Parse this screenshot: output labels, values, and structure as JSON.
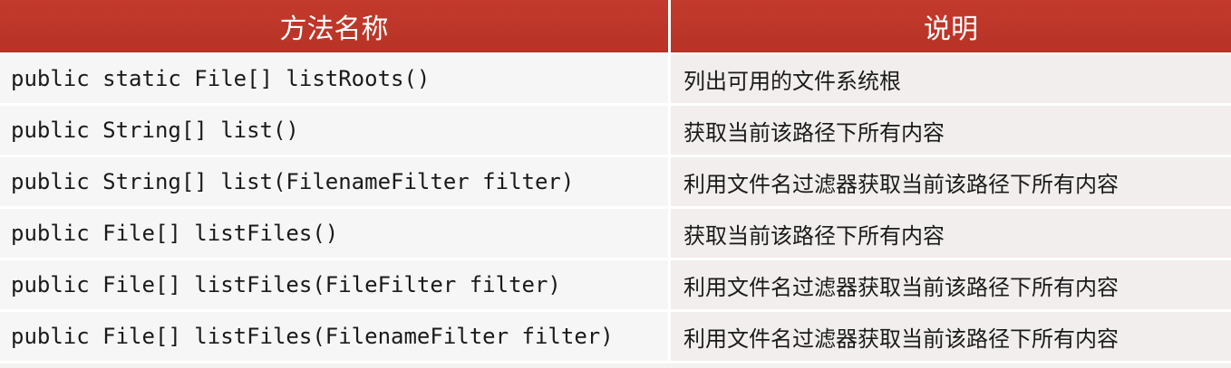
{
  "table": {
    "headers": [
      "方法名称",
      "说明"
    ],
    "rows": [
      {
        "method": "public static File[] listRoots()",
        "desc": "列出可用的文件系统根"
      },
      {
        "method": "public String[] list()",
        "desc": "获取当前该路径下所有内容"
      },
      {
        "method": "public String[] list(FilenameFilter filter)",
        "desc": "利用文件名过滤器获取当前该路径下所有内容"
      },
      {
        "method": "public File[] listFiles()",
        "desc": "获取当前该路径下所有内容"
      },
      {
        "method": "public File[] listFiles(FileFilter filter)",
        "desc": "利用文件名过滤器获取当前该路径下所有内容"
      },
      {
        "method": "public File[] listFiles(FilenameFilter filter)",
        "desc": "利用文件名过滤器获取当前该路径下所有内容"
      }
    ],
    "colors": {
      "header_bg": "#c0392b",
      "header_text": "#ffffff",
      "row_bg": "#f4f2f1"
    }
  }
}
